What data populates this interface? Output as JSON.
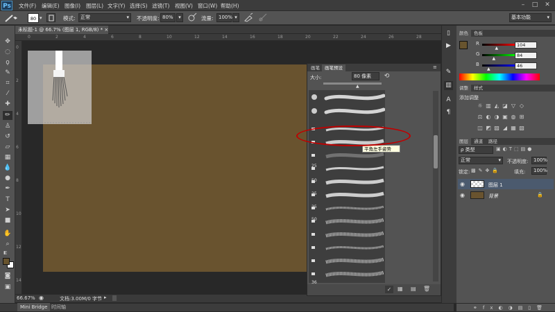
{
  "app": {
    "logo": "Ps",
    "workspace": "基本功能"
  },
  "menu": [
    "文件(F)",
    "编辑(E)",
    "图像(I)",
    "图层(L)",
    "文字(Y)",
    "选择(S)",
    "滤镜(T)",
    "视图(V)",
    "窗口(W)",
    "帮助(H)"
  ],
  "window_controls": [
    "–",
    "□",
    "✕"
  ],
  "options": {
    "brush_size": "80",
    "mode_label": "模式:",
    "mode_value": "正常",
    "opacity_label": "不透明度:",
    "opacity_value": "80%",
    "flow_label": "流量:",
    "flow_value": "100%"
  },
  "document": {
    "tab_title": "未标题-1 @ 66.7% (图层 1, RGB/8) *",
    "close": "×"
  },
  "ruler_top": [
    "0",
    "2",
    "4",
    "6",
    "8",
    "10",
    "12",
    "14",
    "16",
    "18",
    "20",
    "22",
    "24",
    "26",
    "28",
    "30"
  ],
  "ruler_left": [
    "0",
    "2",
    "4",
    "6",
    "8",
    "10",
    "12",
    "14"
  ],
  "status": {
    "zoom": "66.67%",
    "doc_info": "文档:3.00M/0 字节"
  },
  "bottom_tabs": [
    "Mini Bridge",
    "时间轴"
  ],
  "brush_panel": {
    "tabs": [
      "画笔",
      "画笔预设"
    ],
    "size_label": "大小:",
    "size_value": "80 像素",
    "tooltip": "平角左手姿势",
    "numbers": [
      "25",
      "50",
      "25",
      "25",
      "50",
      "36"
    ]
  },
  "color_panel": {
    "tabs": [
      "颜色",
      "色板"
    ],
    "channels": [
      {
        "label": "R",
        "value": "104",
        "fraction": 0.41
      },
      {
        "label": "G",
        "value": "84",
        "fraction": 0.33
      },
      {
        "label": "B",
        "value": "46",
        "fraction": 0.18
      }
    ],
    "foreground": "#68542e"
  },
  "adjust_panel": {
    "tabs": [
      "调整",
      "样式"
    ],
    "title": "添加调整"
  },
  "layers_panel": {
    "tabs": [
      "图层",
      "通道",
      "路径"
    ],
    "kind": "ρ 类型",
    "blend": "正常",
    "opacity_label": "不透明度:",
    "opacity_value": "100%",
    "lock_label": "锁定:",
    "fill_label": "填充:",
    "fill_value": "100%",
    "layers": [
      {
        "name": "图层 1",
        "selected": true
      },
      {
        "name": "背景",
        "selected": false
      }
    ]
  },
  "colors": {
    "canvas": "#69532f",
    "accent_red": "#c00000",
    "highlight": "#4b5a6e"
  }
}
